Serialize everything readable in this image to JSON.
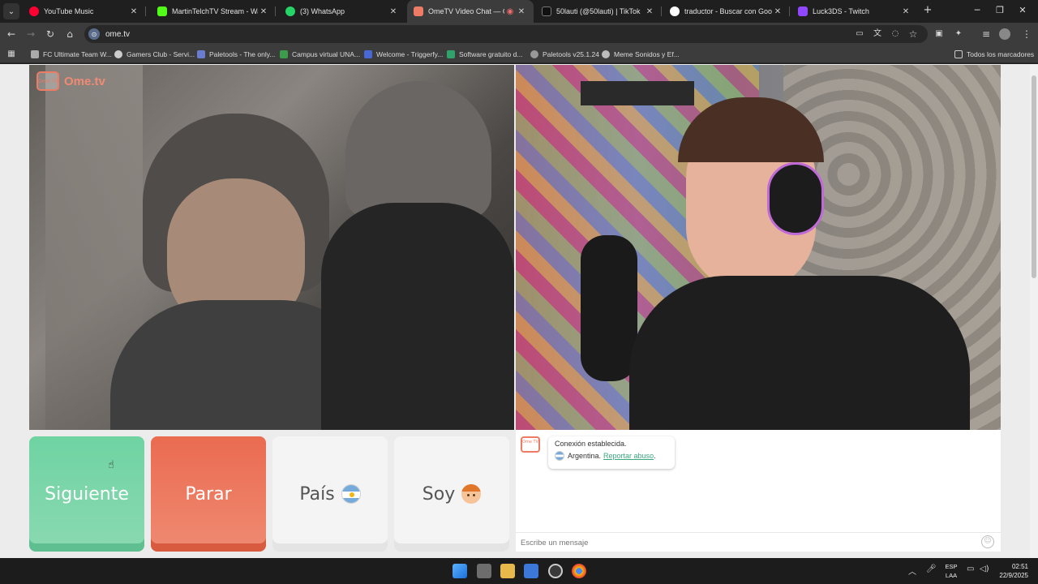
{
  "tabs": [
    {
      "title": "YouTube Music",
      "color": "#ff0033"
    },
    {
      "title": "MartinTelchTV Stream - Watch Live on Kick",
      "color": "#53fc18"
    },
    {
      "title": "(3) WhatsApp",
      "color": "#25d366"
    },
    {
      "title": "OmeTV Video Chat — Omegle",
      "color": "#ee7b63"
    },
    {
      "title": "50lauti (@50lauti) | TikTok",
      "color": "#000000"
    },
    {
      "title": "traductor - Buscar con Google",
      "color": "#4285f4"
    },
    {
      "title": "Luck3DS - Twitch",
      "color": "#9146ff"
    }
  ],
  "omnibox": {
    "url": "ome.tv"
  },
  "bookmarks": [
    {
      "label": "FC Ultimate Team W...",
      "color": "#aaaaaa"
    },
    {
      "label": "Gamers Club - Servi...",
      "color": "#cccccc"
    },
    {
      "label": "Paletools - The only...",
      "color": "#6a7ccf"
    },
    {
      "label": "Campus virtual UNA...",
      "color": "#3b9c4a"
    },
    {
      "label": "Welcome - Triggerfy...",
      "color": "#4a67d6"
    },
    {
      "label": "Software gratuito d...",
      "color": "#2fa36b"
    },
    {
      "label": "Paletools v25.1.24",
      "color": "#999999"
    },
    {
      "label": "Meme Sonidos y Ef...",
      "color": "#bbbbbb"
    }
  ],
  "all_bookmarks": "Todos los marcadores",
  "logo": {
    "name": "Ome.tv",
    "badge": "Ome TV"
  },
  "controls": {
    "next": "Siguiente",
    "stop": "Parar",
    "country": "País",
    "gender": "Soy"
  },
  "chat": {
    "status": "Conexión establecida.",
    "country": "Argentina.",
    "report": "Reportar abuso",
    "report_suffix": ".",
    "placeholder": "Escribe un mensaje"
  },
  "taskbar": {
    "lang_top": "ESP",
    "lang_bottom": "LAA",
    "time": "02:51",
    "date": "22/9/2025"
  },
  "colors": {
    "accent_green": "#6fd3a2",
    "accent_red": "#ea6b50",
    "brand": "#ee7b63"
  }
}
